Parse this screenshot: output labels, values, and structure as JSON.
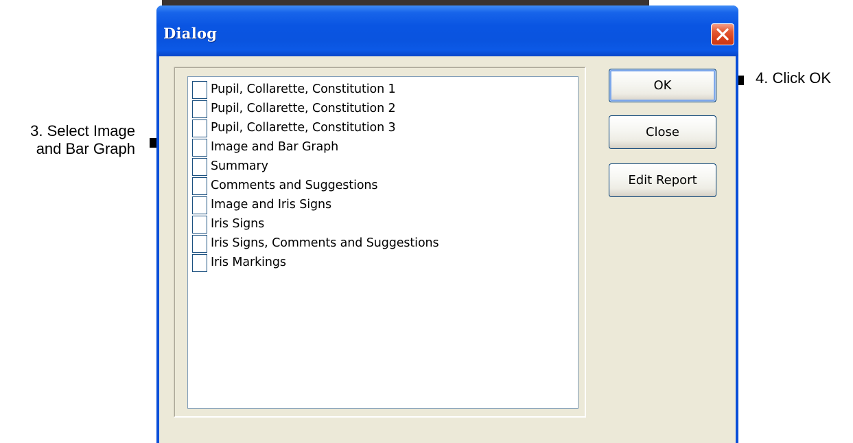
{
  "window": {
    "title": "Dialog",
    "close_icon": "close-x-icon"
  },
  "report_list": {
    "items": [
      {
        "label": "Pupil, Collarette, Constitution 1",
        "checked": false
      },
      {
        "label": "Pupil, Collarette, Constitution 2",
        "checked": false
      },
      {
        "label": "Pupil, Collarette, Constitution 3",
        "checked": false
      },
      {
        "label": "Image and Bar Graph",
        "checked": false
      },
      {
        "label": "Summary",
        "checked": false
      },
      {
        "label": "Comments and Suggestions",
        "checked": false
      },
      {
        "label": "Image and Iris Signs",
        "checked": false
      },
      {
        "label": "Iris Signs",
        "checked": false
      },
      {
        "label": "Iris Signs, Comments and Suggestions",
        "checked": false
      },
      {
        "label": "Iris Markings",
        "checked": false
      }
    ]
  },
  "buttons": {
    "ok": "OK",
    "close": "Close",
    "edit_report": "Edit Report"
  },
  "annotations": {
    "step3_line1": "3. Select Image",
    "step3_line2": "and Bar Graph",
    "step4": "4. Click OK"
  },
  "colors": {
    "titlebar": "#0a55e2",
    "client_bg": "#ece9d8",
    "close_button": "#d8401a",
    "checkbox_border": "#1c5180"
  }
}
